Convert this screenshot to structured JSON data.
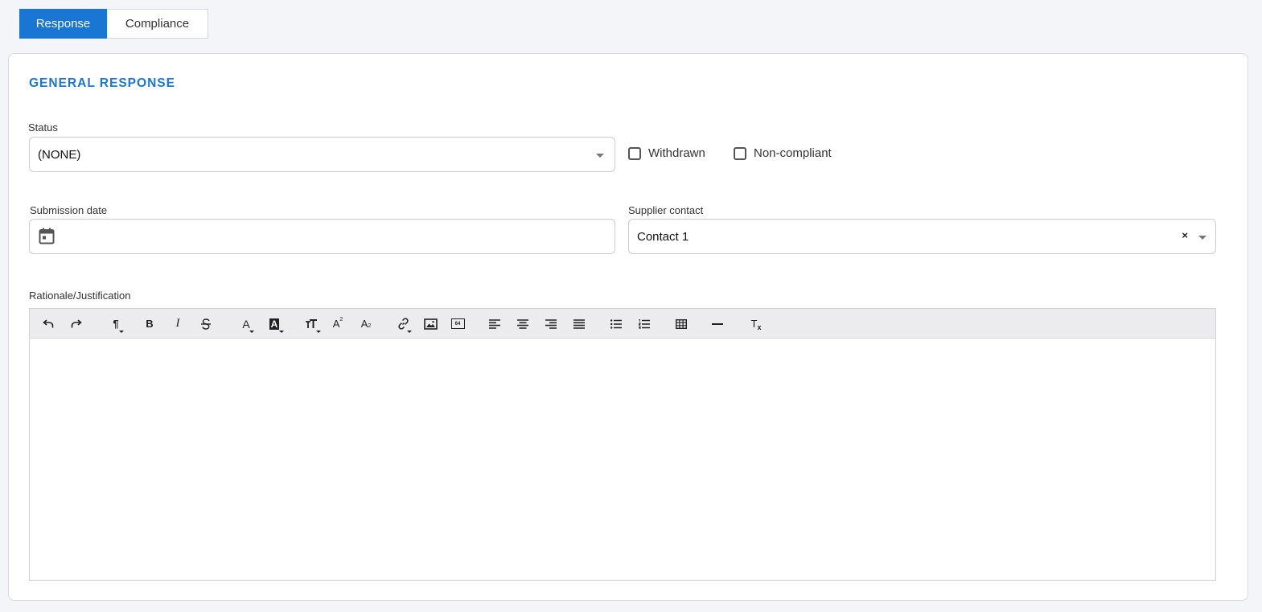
{
  "tabs": [
    {
      "label": "Response",
      "active": true
    },
    {
      "label": "Compliance",
      "active": false
    }
  ],
  "section_title": "GENERAL RESPONSE",
  "status": {
    "label": "Status",
    "value": "(NONE)"
  },
  "checkboxes": {
    "withdrawn": {
      "label": "Withdrawn",
      "checked": false
    },
    "non_compliant": {
      "label": "Non-compliant",
      "checked": false
    }
  },
  "submission_date": {
    "label": "Submission date",
    "value": ""
  },
  "supplier_contact": {
    "label": "Supplier contact",
    "value": "Contact 1",
    "clear_glyph": "×"
  },
  "rationale": {
    "label": "Rationale/Justification",
    "content": ""
  },
  "toolbar_text": {
    "bold": "B",
    "italic": "I",
    "font_color": "A",
    "highlight": "A",
    "superscript_base": "A",
    "superscript_mark": "2",
    "subscript_base": "A",
    "subscript_mark": "2",
    "base64": "64",
    "paragraph": "¶",
    "clear_format_base": "T",
    "clear_format_mark": "x"
  },
  "toolbar_icons": [
    "undo-icon",
    "redo-icon",
    "paragraph-format-icon",
    "bold-icon",
    "italic-icon",
    "strikethrough-icon",
    "font-color-icon",
    "highlight-color-icon",
    "font-size-icon",
    "superscript-icon",
    "subscript-icon",
    "link-icon",
    "image-icon",
    "base64-image-icon",
    "align-left-icon",
    "align-center-icon",
    "align-right-icon",
    "align-justify-icon",
    "bullet-list-icon",
    "numbered-list-icon",
    "table-icon",
    "horizontal-rule-icon",
    "clear-format-icon"
  ],
  "colors": {
    "accent": "#1976d2",
    "background": "#f4f5f9"
  }
}
